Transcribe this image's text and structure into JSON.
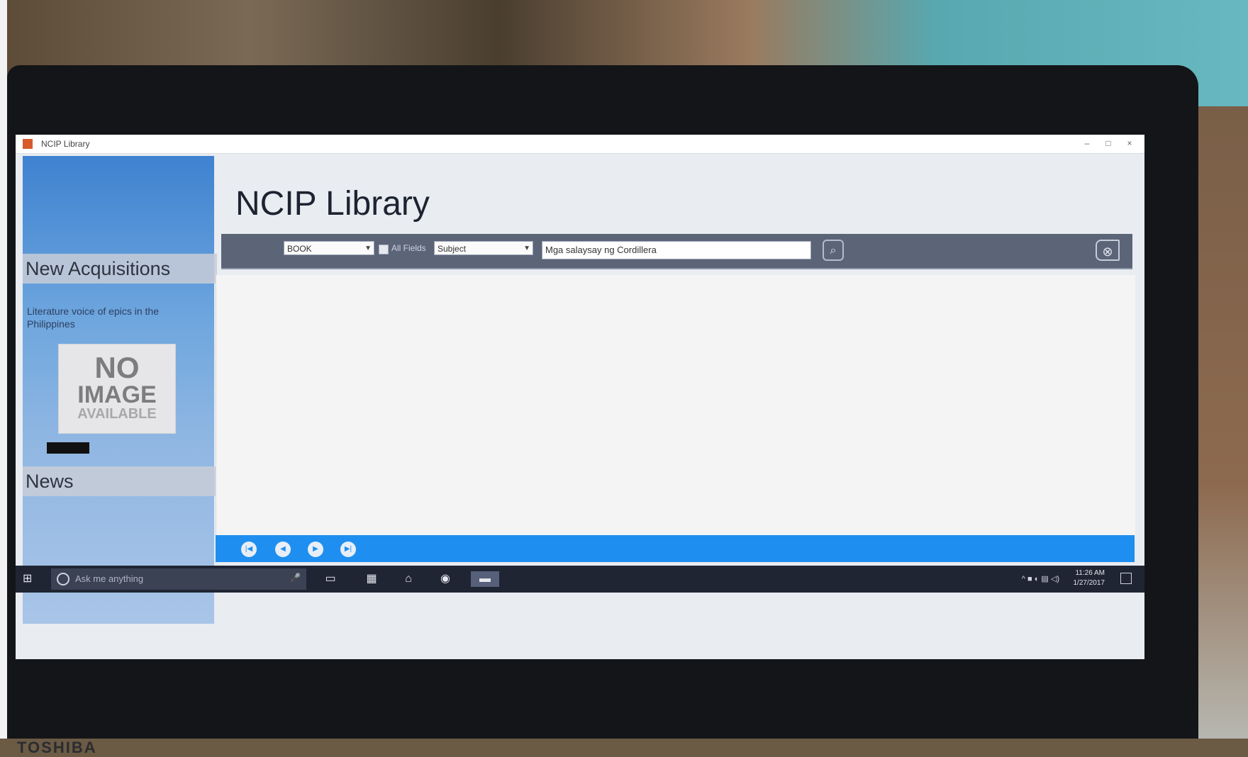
{
  "window": {
    "title": "NCIP Library",
    "controls": [
      "–",
      "□",
      "×"
    ]
  },
  "sidebar": {
    "new_acquisitions_heading": "New Acquisitions",
    "book_description": "Literature voice of epics in the Philippines",
    "no_image": {
      "line1": "NO",
      "line2": "IMAGE",
      "line3": "AVAILABLE"
    },
    "news_heading": "News"
  },
  "main": {
    "title": "NCIP Library",
    "search": {
      "category_value": "BOOK",
      "checkbox_label": "All Fields",
      "field_value": "Subject",
      "query_value": "Mga salaysay ng Cordillera",
      "search_icon": "search-icon",
      "exit_icon": "exit-icon"
    }
  },
  "statusbar": {
    "nav_buttons": [
      "|◀",
      "◀",
      "▶",
      "▶|"
    ]
  },
  "taskbar": {
    "cortana_placeholder": "Ask me anything",
    "time": "11:26 AM",
    "date": "1/27/2017"
  },
  "device": {
    "brand": "TOSHIBA"
  }
}
